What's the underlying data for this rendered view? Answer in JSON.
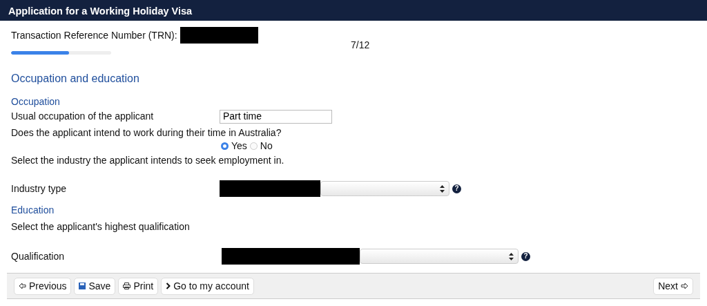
{
  "header": {
    "title": "Application for a Working Holiday Visa"
  },
  "trn": {
    "label": "Transaction Reference Number (TRN):",
    "redacted": true
  },
  "progress": {
    "step": "7/12",
    "level": 0.58
  },
  "page_heading": "Occupation and education",
  "sections": [
    {
      "title": "Occupation",
      "items": [
        {
          "kind": "text",
          "label": "Usual occupation of the applicant",
          "value": "Part time"
        },
        {
          "kind": "radio",
          "label": "Does the applicant intend to work during their time in Australia?",
          "options": [
            {
              "label": "Yes",
              "selected": true
            },
            {
              "label": "No",
              "selected": false
            }
          ]
        },
        {
          "kind": "note",
          "label": "Select the industry the applicant intends to seek employment in."
        },
        {
          "kind": "select",
          "label": "Industry type",
          "help": "?",
          "redacted": true
        }
      ]
    },
    {
      "title": "Education",
      "items": [
        {
          "kind": "note",
          "label": "Select the applicant's highest qualification"
        },
        {
          "kind": "select",
          "label": "Qualification",
          "help": "?",
          "redacted": true
        }
      ]
    }
  ],
  "footer": {
    "left_buttons": [
      {
        "kind": "previous",
        "label": "Previous"
      },
      {
        "kind": "save",
        "label": "Save"
      },
      {
        "kind": "print",
        "label": "Print"
      },
      {
        "kind": "account",
        "label": "Go to my account"
      }
    ],
    "right_buttons": [
      {
        "kind": "next",
        "label": "Next"
      }
    ]
  }
}
